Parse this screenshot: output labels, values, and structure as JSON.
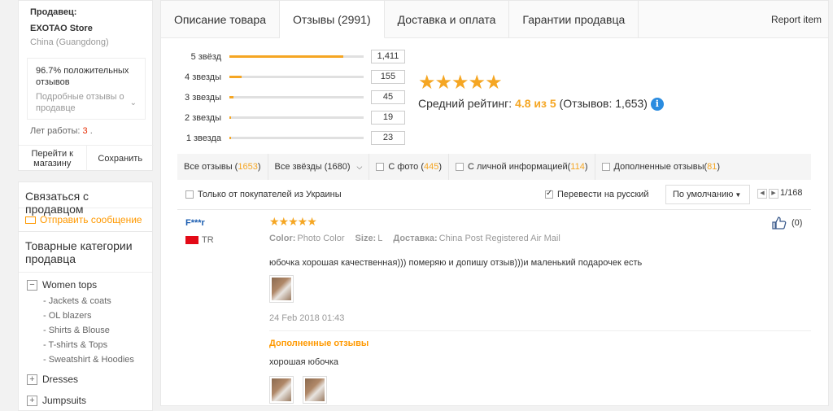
{
  "seller": {
    "label": "Продавец:",
    "store_name": "EXOTAO Store",
    "location": "China (Guangdong)",
    "feedback_value": "96.7%",
    "feedback_text": "положительных отзывов",
    "feedback_detail": "Подробные отзывы о продавце",
    "years_label": "Лет работы:",
    "years_value": "3",
    "years_suffix": ".",
    "goto_store": "Перейти к магазину",
    "save": "Сохранить"
  },
  "contact": {
    "title": "Связаться с продавцом",
    "send_message": "Отправить сообщение"
  },
  "categories": {
    "title": "Товарные категории продавца",
    "group1": "Women tops",
    "subitems": [
      "- Jackets & coats",
      "- OL blazers",
      "- Shirts & Blouse",
      "- T-shirts & Tops",
      "- Sweatshirt & Hoodies"
    ],
    "group2": "Dresses",
    "group3": "Jumpsuits"
  },
  "tabs": {
    "description": "Описание товара",
    "reviews": "Отзывы (2991)",
    "shipping": "Доставка и оплата",
    "guarantees": "Гарантии продавца",
    "report": "Report item"
  },
  "distribution": [
    {
      "label": "5 звёзд",
      "count": "1,411",
      "fraction": 0.85
    },
    {
      "label": "4 звезды",
      "count": "155",
      "fraction": 0.09
    },
    {
      "label": "3 звезды",
      "count": "45",
      "fraction": 0.03
    },
    {
      "label": "2 звезды",
      "count": "19",
      "fraction": 0.01
    },
    {
      "label": "1 звезда",
      "count": "23",
      "fraction": 0.01
    }
  ],
  "summary": {
    "stars": "★★★★★",
    "avg_label": "Средний рейтинг:",
    "avg_value": "4.8 из 5",
    "count_text": "(Отзывов: 1,653)",
    "info": "i"
  },
  "filters": {
    "all_reviews": "Все отзывы (",
    "all_reviews_count": "1653",
    "all_reviews_end": ")",
    "all_stars": "Все звёзды (1680)",
    "with_photo": "С фото (",
    "with_photo_count": "445",
    "with_photo_end": ")",
    "personal": "С личной информацией(",
    "personal_count": "114",
    "personal_end": ")",
    "additional": "Дополненные отзывы(",
    "additional_count": "81",
    "additional_end": ")"
  },
  "options": {
    "ukraine_only": "Только от покупателей из Украины",
    "translate": "Перевести на русский",
    "sort": "По умолчанию",
    "page": "1/168"
  },
  "review": {
    "user": "F***r",
    "country": "TR",
    "stars": "★★★★★",
    "color_label": "Color:",
    "color_value": "Photo Color",
    "size_label": "Size:",
    "size_value": "L",
    "delivery_label": "Доставка:",
    "delivery_value": "China Post Registered Air Mail",
    "text": "юбочка хорошая качественная))) померяю и допишу отзыв)))и маленький подарочек есть",
    "date": "24 Feb 2018 01:43",
    "additional_title": "Дополненные отзывы",
    "additional_text": "хорошая юбочка",
    "likes": "(0)"
  }
}
